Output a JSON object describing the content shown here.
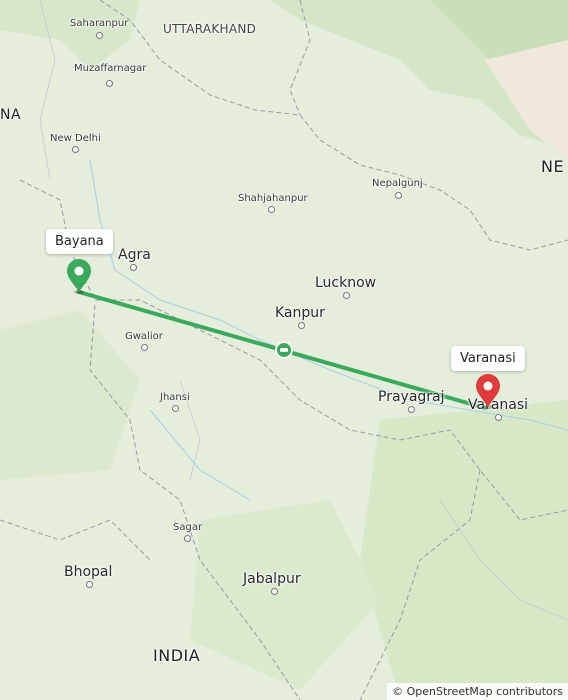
{
  "map": {
    "route_color": "#3aa95c",
    "origin_color": "#3aa95c",
    "destination_color": "#e03b3b",
    "cities": {
      "saharanpur": "Saharanpur",
      "muzaffarnagar": "Muzaffarnagar",
      "new_delhi": "New Delhi",
      "shahjahanpur": "Shahjahanpur",
      "nepalgunj": "Nepalgunj",
      "agra": "Agra",
      "lucknow": "Lucknow",
      "kanpur": "Kanpur",
      "gwalior": "Gwalior",
      "jhansi": "Jhansi",
      "prayagraj": "Prayagraj",
      "varanasi": "Varanasi",
      "sagar": "Sagar",
      "bhopal": "Bhopal",
      "jabalpur": "Jabalpur"
    },
    "regions": {
      "uttarakhand": "UTTARAKHAND",
      "india": "INDIA",
      "cut_left": "NA",
      "cut_right": "NE"
    },
    "origin": {
      "label": "Bayana",
      "icon": "map-pin-icon"
    },
    "destination": {
      "label": "Varanasi",
      "icon": "map-pin-icon"
    },
    "route_midpoint_icon": "car-icon",
    "attribution": "© OpenStreetMap contributors"
  }
}
